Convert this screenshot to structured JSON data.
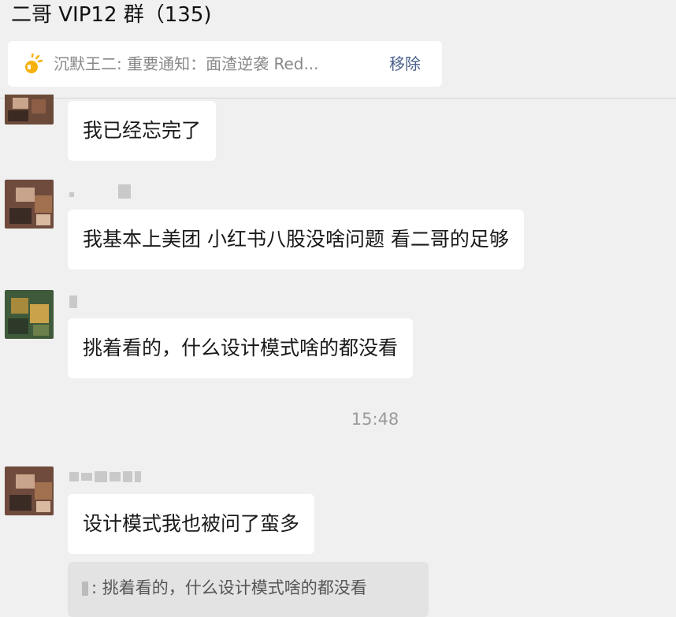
{
  "header": {
    "title": "二哥 VIP12 群（135)"
  },
  "notice": {
    "icon": "announcement-icon",
    "text": "沉默王二: 重要通知：面渣逆袭 Red...",
    "remove_label": "移除"
  },
  "messages": [
    {
      "text": "我已经忘完了"
    },
    {
      "text": "我基本上美团 小红书八股没啥问题 看二哥的足够"
    },
    {
      "text": "挑着看的，什么设计模式啥的都没看"
    },
    {
      "text": "设计模式我也被问了蛮多"
    }
  ],
  "timestamp": "15:48",
  "quote": {
    "text": ": 挑着看的，什么设计模式啥的都没看"
  },
  "colors": {
    "background": "#f0f0f0",
    "bubble": "#ffffff",
    "accent_link": "#4a5f8a",
    "notice_icon": "#f5b10a"
  }
}
